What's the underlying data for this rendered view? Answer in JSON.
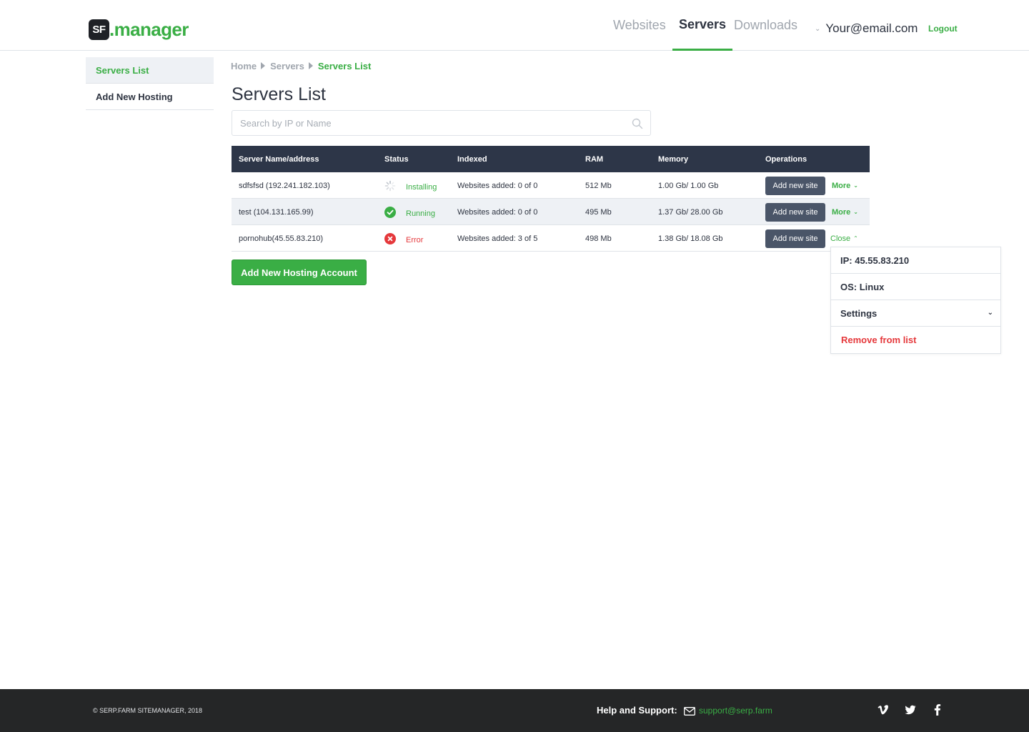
{
  "app": {
    "logo_abbr": "SF",
    "logo_text": ".manager"
  },
  "header": {
    "nav": [
      {
        "label": "Websites",
        "active": false
      },
      {
        "label": "Servers",
        "active": true
      },
      {
        "label": "Downloads",
        "active": false
      }
    ],
    "user_email": "Your@email.com",
    "logout_label": "Logout"
  },
  "sidebar": {
    "items": [
      {
        "label": "Servers List",
        "active": true
      },
      {
        "label": "Add New Hosting",
        "active": false
      }
    ]
  },
  "breadcrumb": [
    "Home",
    "Servers",
    "Servers List"
  ],
  "page_title": "Servers List",
  "search": {
    "placeholder": "Search by IP or Name",
    "value": ""
  },
  "table": {
    "columns": [
      "Server Name/address",
      "Status",
      "Indexed",
      "RAM",
      "Memory",
      "Operations"
    ],
    "rows": [
      {
        "name": "sdfsfsd (192.241.182.103)",
        "status": "Installing",
        "indexed": "Websites added: 0 of 0",
        "ram": "512 Mb",
        "memory": "1.00 Gb/ 1.00 Gb",
        "add_label": "Add new site",
        "toggle_label": "More"
      },
      {
        "name": "test (104.131.165.99)",
        "status": "Running",
        "indexed": "Websites added: 0 of 0",
        "ram": "495 Mb",
        "memory": "1.37 Gb/ 28.00 Gb",
        "add_label": "Add new site",
        "toggle_label": "More"
      },
      {
        "name": "pornohub(45.55.83.210)",
        "status": "Error",
        "indexed": "Websites added: 3 of 5",
        "ram": "498 Mb",
        "memory": "1.38 Gb/ 18.08 Gb",
        "add_label": "Add new site",
        "toggle_label": "Close"
      }
    ]
  },
  "dropdown": {
    "ip": "IP: 45.55.83.210",
    "os": "OS: Linux",
    "settings": "Settings",
    "remove": "Remove from list"
  },
  "add_account_button": "Add New Hosting Account",
  "footer": {
    "copyright": "© SERP.FARM SITEMANAGER, 2018",
    "help_label": "Help and Support:",
    "support_email": "support@serp.farm",
    "social": [
      "vimeo-icon",
      "twitter-icon",
      "facebook-icon"
    ]
  },
  "colors": {
    "accent": "#3aae45",
    "table_header": "#2d3648",
    "error": "#e5383b",
    "footer": "#252627"
  }
}
